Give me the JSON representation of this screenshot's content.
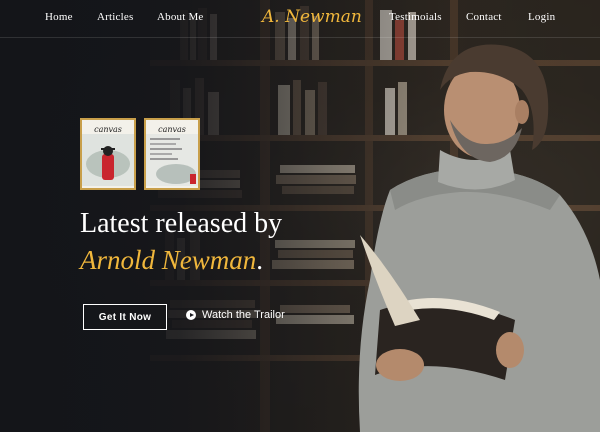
{
  "nav": {
    "left": [
      "Home",
      "Articles",
      "About Me"
    ],
    "brand": "A. Newman",
    "right": [
      "Testimoials",
      "Contact",
      "Login"
    ]
  },
  "covers": [
    {
      "title": "canvas"
    },
    {
      "title": "canvas"
    }
  ],
  "hero": {
    "line1": "Latest released by",
    "author": "Arnold Newman",
    "dot": ".",
    "cta": "Get It Now",
    "trailer": "Watch the Trailor"
  },
  "colors": {
    "accent": "#f0b73c",
    "background": "#1c1d22"
  }
}
